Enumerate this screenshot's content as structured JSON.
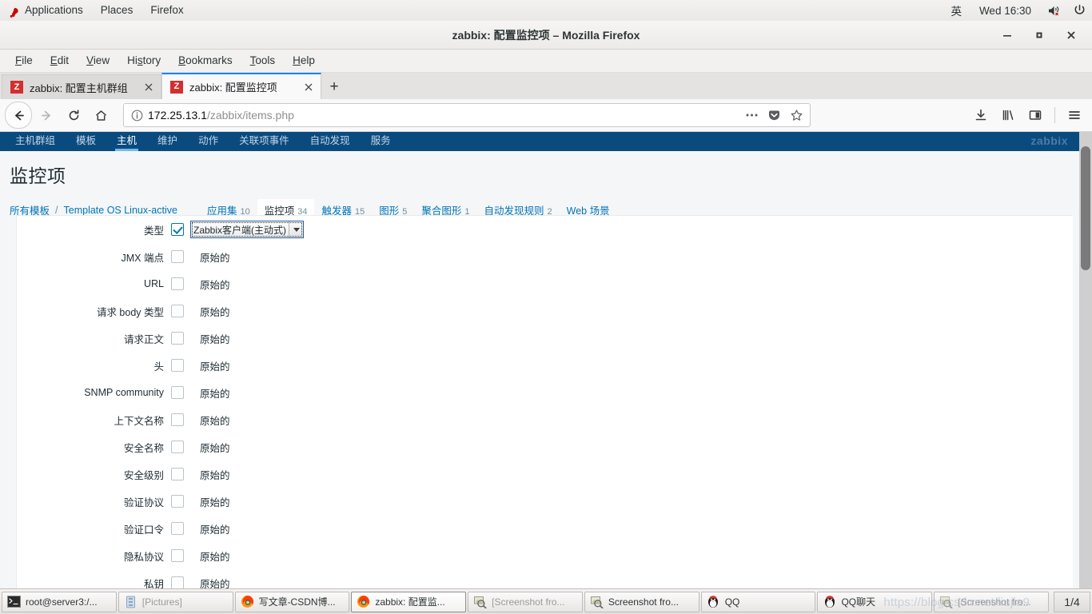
{
  "gnome_panel": {
    "applications": "Applications",
    "places": "Places",
    "firefox": "Firefox",
    "lang": "英",
    "clock": "Wed 16:30",
    "volume_icon": "volume-muted-icon",
    "power_icon": "power-icon"
  },
  "browser": {
    "window_title": "zabbix: 配置监控项 – Mozilla Firefox",
    "menu": [
      "File",
      "Edit",
      "View",
      "History",
      "Bookmarks",
      "Tools",
      "Help"
    ],
    "tabs": [
      {
        "favicon": "Z",
        "label": "zabbix: 配置主机群组",
        "active": false
      },
      {
        "favicon": "Z",
        "label": "zabbix: 配置监控项",
        "active": true
      }
    ],
    "new_tab_label": "+",
    "url_host": "172.25.13.1",
    "url_path": "/zabbix/items.php",
    "minimize_label": "—",
    "maximize_label": "□",
    "close_label": "✕"
  },
  "zabbix": {
    "nav": [
      {
        "label": "主机群组",
        "active": false
      },
      {
        "label": "模板",
        "active": false
      },
      {
        "label": "主机",
        "active": true
      },
      {
        "label": "维护",
        "active": false
      },
      {
        "label": "动作",
        "active": false
      },
      {
        "label": "关联项事件",
        "active": false
      },
      {
        "label": "自动发现",
        "active": false
      },
      {
        "label": "服务",
        "active": false
      }
    ],
    "brand": "zabbix",
    "page_title": "监控项",
    "breadcrumb": {
      "root": "所有模板",
      "separator": "/",
      "current": "Template OS Linux-active"
    },
    "subtabs": [
      {
        "label": "应用集",
        "count": "10",
        "selected": false
      },
      {
        "label": "监控项",
        "count": "34",
        "selected": true
      },
      {
        "label": "触发器",
        "count": "15",
        "selected": false
      },
      {
        "label": "图形",
        "count": "5",
        "selected": false
      },
      {
        "label": "聚合图形",
        "count": "1",
        "selected": false
      },
      {
        "label": "自动发现规则",
        "count": "2",
        "selected": false
      },
      {
        "label": "Web 场景",
        "count": "",
        "selected": false
      }
    ],
    "form_rows": [
      {
        "label": "类型",
        "checked": true,
        "control": "select",
        "value": "Zabbix客户端(主动式)"
      },
      {
        "label": "JMX 端点",
        "checked": false,
        "control": "text",
        "value": "原始的"
      },
      {
        "label": "URL",
        "checked": false,
        "control": "text",
        "value": "原始的"
      },
      {
        "label": "请求 body 类型",
        "checked": false,
        "control": "text",
        "value": "原始的"
      },
      {
        "label": "请求正文",
        "checked": false,
        "control": "text",
        "value": "原始的"
      },
      {
        "label": "头",
        "checked": false,
        "control": "text",
        "value": "原始的"
      },
      {
        "label": "SNMP community",
        "checked": false,
        "control": "text",
        "value": "原始的"
      },
      {
        "label": "上下文名称",
        "checked": false,
        "control": "text",
        "value": "原始的"
      },
      {
        "label": "安全名称",
        "checked": false,
        "control": "text",
        "value": "原始的"
      },
      {
        "label": "安全级别",
        "checked": false,
        "control": "text",
        "value": "原始的"
      },
      {
        "label": "验证协议",
        "checked": false,
        "control": "text",
        "value": "原始的"
      },
      {
        "label": "验证口令",
        "checked": false,
        "control": "text",
        "value": "原始的"
      },
      {
        "label": "隐私协议",
        "checked": false,
        "control": "text",
        "value": "原始的"
      },
      {
        "label": "私钥",
        "checked": false,
        "control": "text",
        "value": "原始的"
      }
    ]
  },
  "taskbar": {
    "buttons": [
      {
        "icon": "terminal-icon",
        "label": "root@server3:/...",
        "state": "normal"
      },
      {
        "icon": "archive-icon",
        "label": "[Pictures]",
        "state": "dim"
      },
      {
        "icon": "firefox-icon",
        "label": "写文章-CSDN博...",
        "state": "normal"
      },
      {
        "icon": "firefox-icon",
        "label": "zabbix: 配置监...",
        "state": "active"
      },
      {
        "icon": "screenshot-icon",
        "label": "[Screenshot fro...",
        "state": "dim"
      },
      {
        "icon": "screenshot-icon",
        "label": "Screenshot fro...",
        "state": "normal"
      },
      {
        "icon": "qq-icon",
        "label": "QQ",
        "state": "normal"
      },
      {
        "icon": "qq-icon",
        "label": "QQ聊天",
        "state": "normal"
      },
      {
        "icon": "screenshot-icon",
        "label": "[Screenshot fro...",
        "state": "dim"
      }
    ],
    "workspace": "1/4",
    "watermark": "https://blog.csdn.net/liujia9"
  }
}
